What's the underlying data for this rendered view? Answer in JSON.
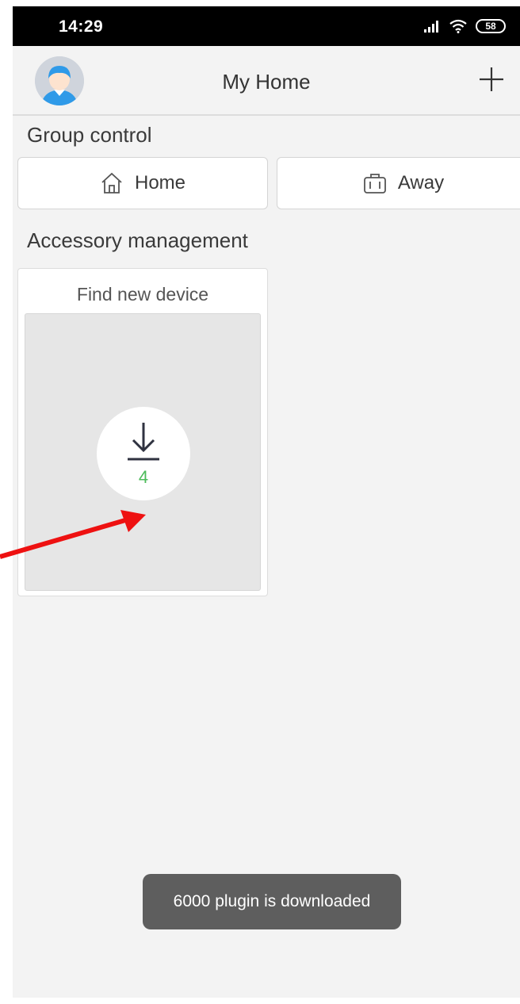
{
  "status_bar": {
    "time": "14:29",
    "battery": "58",
    "icons": [
      "signal-icon",
      "wifi-icon",
      "battery-icon"
    ]
  },
  "header": {
    "title": "My Home",
    "avatar_icon": "user-avatar",
    "add_icon": "plus-icon"
  },
  "group_control": {
    "title": "Group control",
    "buttons": [
      {
        "label": "Home",
        "icon": "house-icon"
      },
      {
        "label": "Away",
        "icon": "briefcase-icon"
      }
    ]
  },
  "accessory": {
    "title": "Accessory management",
    "card": {
      "title": "Find new device",
      "icon": "download-icon",
      "count": "4"
    }
  },
  "toast": {
    "message": "6000 plugin is downloaded"
  },
  "colors": {
    "background": "#f3f3f3",
    "status_bar": "#000000",
    "count_green": "#4cbb5a",
    "toast_bg": "#5e5e5e",
    "annotation_red": "#ee1111",
    "avatar_blue": "#2f9ae8"
  }
}
